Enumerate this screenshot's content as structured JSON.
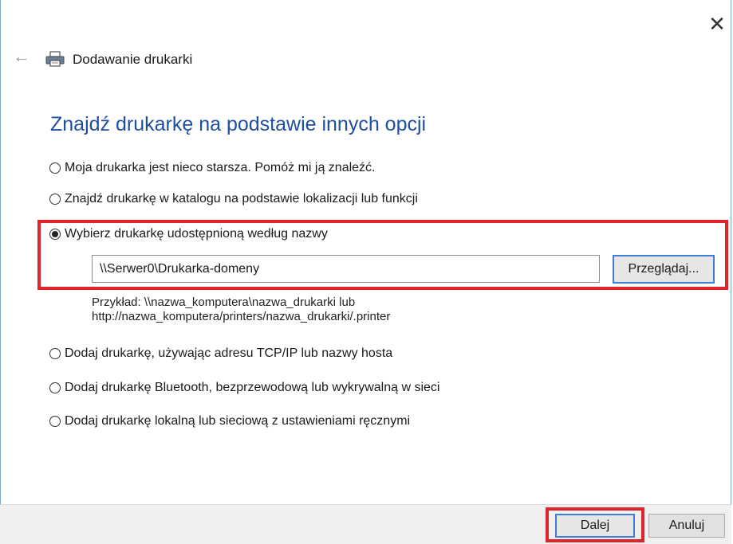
{
  "window": {
    "close_glyph": "✕",
    "back_glyph": "←",
    "title": "Dodawanie drukarki",
    "heading": "Znajdź drukarkę na podstawie innych opcji"
  },
  "options": [
    {
      "label": "Moja drukarka jest nieco starsza. Pomóż mi ją znaleźć.",
      "selected": false
    },
    {
      "label": "Znajdź drukarkę w katalogu na podstawie lokalizacji lub funkcji",
      "selected": false
    },
    {
      "label": "Wybierz drukarkę udostępnioną według nazwy",
      "selected": true
    },
    {
      "label": "Dodaj drukarkę, używając adresu TCP/IP lub nazwy hosta",
      "selected": false
    },
    {
      "label": "Dodaj drukarkę Bluetooth, bezprzewodową lub wykrywalną w sieci",
      "selected": false
    },
    {
      "label": "Dodaj drukarkę lokalną lub sieciową z ustawieniami ręcznymi",
      "selected": false
    }
  ],
  "shared_printer": {
    "path_value": "\\\\Serwer0\\Drukarka-domeny",
    "browse_label": "Przeglądaj...",
    "example_line1": "Przykład: \\\\nazwa_komputera\\nazwa_drukarki lub",
    "example_line2": "http://nazwa_komputera/printers/nazwa_drukarki/.printer"
  },
  "footer": {
    "next_label": "Dalej",
    "cancel_label": "Anuluj"
  },
  "colors": {
    "heading": "#1f4fa0",
    "highlight": "#e0242c",
    "focus_border": "#3c7dd6"
  },
  "icons": [
    "close-icon",
    "back-arrow-icon",
    "printer-icon"
  ]
}
